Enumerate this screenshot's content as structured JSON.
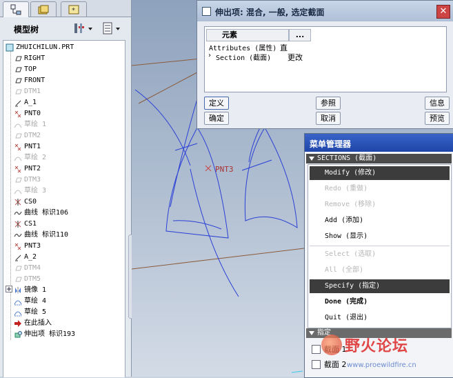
{
  "model_tree": {
    "title": "模型树",
    "root": "ZHUICHILUN.PRT",
    "items": [
      {
        "label": "RIGHT",
        "icon": "datum-plane-icon",
        "dim": false
      },
      {
        "label": "TOP",
        "icon": "datum-plane-icon",
        "dim": false
      },
      {
        "label": "FRONT",
        "icon": "datum-plane-icon",
        "dim": false
      },
      {
        "label": "DTM1",
        "icon": "datum-plane-icon",
        "dim": true
      },
      {
        "label": "A_1",
        "icon": "datum-axis-icon",
        "dim": false
      },
      {
        "label": "PNT0",
        "icon": "datum-point-icon",
        "dim": false
      },
      {
        "label": "草绘 1",
        "icon": "sketch-icon",
        "dim": true
      },
      {
        "label": "DTM2",
        "icon": "datum-plane-icon",
        "dim": true
      },
      {
        "label": "PNT1",
        "icon": "datum-point-icon",
        "dim": false
      },
      {
        "label": "草绘 2",
        "icon": "sketch-icon",
        "dim": true
      },
      {
        "label": "PNT2",
        "icon": "datum-point-icon",
        "dim": false
      },
      {
        "label": "DTM3",
        "icon": "datum-plane-icon",
        "dim": true
      },
      {
        "label": "草绘 3",
        "icon": "sketch-icon",
        "dim": true
      },
      {
        "label": "CS0",
        "icon": "coordinate-system-icon",
        "dim": false
      },
      {
        "label": "曲线 标识106",
        "icon": "curve-icon",
        "dim": false
      },
      {
        "label": "CS1",
        "icon": "coordinate-system-icon",
        "dim": false
      },
      {
        "label": "曲线 标识110",
        "icon": "curve-icon",
        "dim": false
      },
      {
        "label": "PNT3",
        "icon": "datum-point-icon",
        "dim": false
      },
      {
        "label": "A_2",
        "icon": "datum-axis-icon",
        "dim": false
      },
      {
        "label": "DTM4",
        "icon": "datum-plane-icon",
        "dim": true
      },
      {
        "label": "DTM5",
        "icon": "datum-plane-icon",
        "dim": true
      },
      {
        "label": "镜像 1",
        "icon": "mirror-icon",
        "dim": false
      },
      {
        "label": "草绘 4",
        "icon": "sketch-icon",
        "dim": false
      },
      {
        "label": "草绘 5",
        "icon": "sketch-icon",
        "dim": false
      },
      {
        "label": "在此插入",
        "icon": "insert-here-arrow-icon",
        "dim": false
      },
      {
        "label": "伸出项 标识193",
        "icon": "protrusion-icon",
        "dim": false
      }
    ]
  },
  "graphics": {
    "point_label": "PNT3"
  },
  "dialog": {
    "title": "伸出项: 混合, 一般, 选定截面",
    "col_element": "元素",
    "col_info": "...",
    "rows": [
      {
        "name": "Attributes (属性)",
        "value": "直"
      },
      {
        "name": "Section (截面)",
        "value": "更改"
      }
    ],
    "buttons": {
      "define": "定义",
      "reference": "参照",
      "info": "信息",
      "ok": "确定",
      "cancel": "取消",
      "preview": "预览"
    }
  },
  "menu_manager": {
    "title": "菜单管理器",
    "section1": "SECTIONS (截面)",
    "items": [
      {
        "label": "Modify (修改)",
        "state": "highlighted"
      },
      {
        "label": "Redo (重做)",
        "state": "disabled"
      },
      {
        "label": "Remove (移除)",
        "state": "disabled"
      },
      {
        "label": "Add (添加)",
        "state": "normal"
      },
      {
        "label": "Show (显示)",
        "state": "normal"
      },
      {
        "label": "Select (选取)",
        "state": "disabled"
      },
      {
        "label": "All (全部)",
        "state": "disabled"
      },
      {
        "label": "Specify (指定)",
        "state": "highlighted"
      },
      {
        "label": "Done (完成)",
        "state": "bold"
      },
      {
        "label": "Quit (退出)",
        "state": "normal"
      }
    ],
    "section2": "指定",
    "checkboxes": [
      "截面 1",
      "截面 2"
    ]
  },
  "watermark": {
    "text": "野火论坛",
    "url": "www.proewildfire.cn"
  },
  "colors": {
    "highlight": "#3c3c3c",
    "menu_title": "#2a52bc",
    "curve": "#2a3fd6"
  }
}
